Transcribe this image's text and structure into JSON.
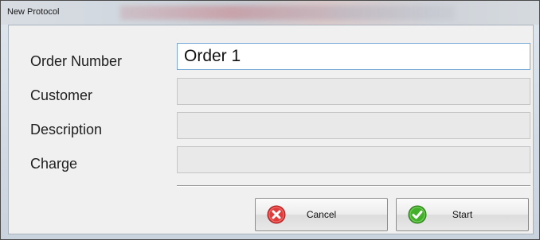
{
  "window": {
    "title": "New Protocol"
  },
  "form": {
    "fields": [
      {
        "label": "Order Number",
        "value": "Order 1"
      },
      {
        "label": "Customer",
        "value": ""
      },
      {
        "label": "Description",
        "value": ""
      },
      {
        "label": "Charge",
        "value": ""
      }
    ]
  },
  "buttons": {
    "cancel_label": "Cancel",
    "start_label": "Start"
  },
  "colors": {
    "cancel_icon": "#e23b3b",
    "start_icon": "#43b02a"
  }
}
